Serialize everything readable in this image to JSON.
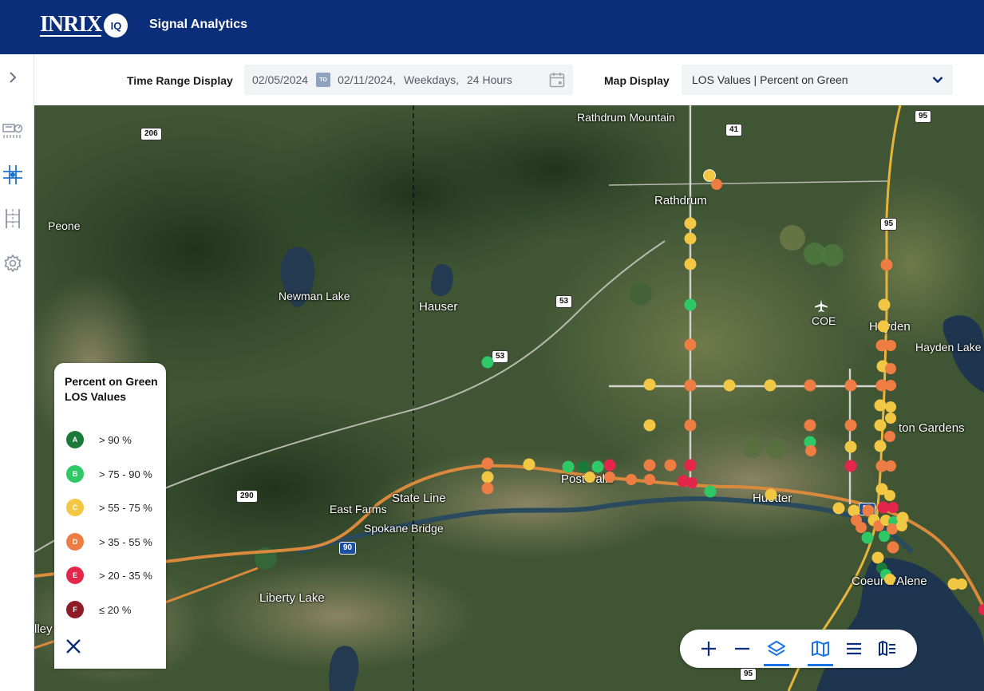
{
  "header": {
    "logo_text": "INRIX",
    "logo_badge": "IQ",
    "title": "Signal Analytics"
  },
  "controls": {
    "time_range_label": "Time Range Display",
    "start_date": "02/05/2024",
    "to_badge": "TO",
    "end_date": "02/11/2024",
    "days": "Weekdays",
    "hours": "24 Hours",
    "map_display_label": "Map Display",
    "map_display_value": "LOS Values | Percent on Green"
  },
  "map": {
    "labels": {
      "rathdrum_mountain": "Rathdrum Mountain",
      "rathdrum": "Rathdrum",
      "peone": "Peone",
      "newman_lake": "Newman Lake",
      "hauser": "Hauser",
      "coe": "COE",
      "hayden": "Hayden",
      "hayden_lake": "Hayden Lake",
      "dalton_gardens": "ton Gardens",
      "post_falls": "Post Falls",
      "huetter": "Huetter",
      "state_line": "State Line",
      "east_farms": "East Farms",
      "spokane_bridge": "Spokane Bridge",
      "liberty_lake": "Liberty Lake",
      "coeur_dalene": "Coeur d'Alene",
      "valley": "lley"
    },
    "shields": {
      "r206": "206",
      "r41": "41",
      "r95_top": "95",
      "r95_mid": "95",
      "r53_a": "53",
      "r53_b": "53",
      "r290": "290",
      "i90_a": "90",
      "i90_b": "90",
      "r95_bottom": "95"
    }
  },
  "legend": {
    "title": "Percent on Green LOS Values",
    "items": [
      {
        "grade": "A",
        "range": "> 90 %",
        "color": "#1b7a3a"
      },
      {
        "grade": "B",
        "range": "> 75 - 90 %",
        "color": "#2ec866"
      },
      {
        "grade": "C",
        "range": "> 55 - 75 %",
        "color": "#f2c744"
      },
      {
        "grade": "D",
        "range": "> 35 - 55 %",
        "color": "#ee7d43"
      },
      {
        "grade": "E",
        "range": "> 20 - 35 %",
        "color": "#e3264a"
      },
      {
        "grade": "F",
        "range": "≤ 20 %",
        "color": "#8e1b26"
      }
    ]
  },
  "colors": {
    "header_bg": "#0b2e7a",
    "accent": "#1a73e8",
    "icon_blue": "#1f72c9"
  },
  "icons": {
    "sidebar": [
      "chevron-right-icon",
      "dashboard-gauge-icon",
      "intersection-network-icon",
      "corridor-icon",
      "gear-icon"
    ],
    "toolbar": [
      "zoom-in-icon",
      "zoom-out-icon",
      "layers-icon",
      "map-icon",
      "menu-icon",
      "map-legend-icon"
    ]
  }
}
